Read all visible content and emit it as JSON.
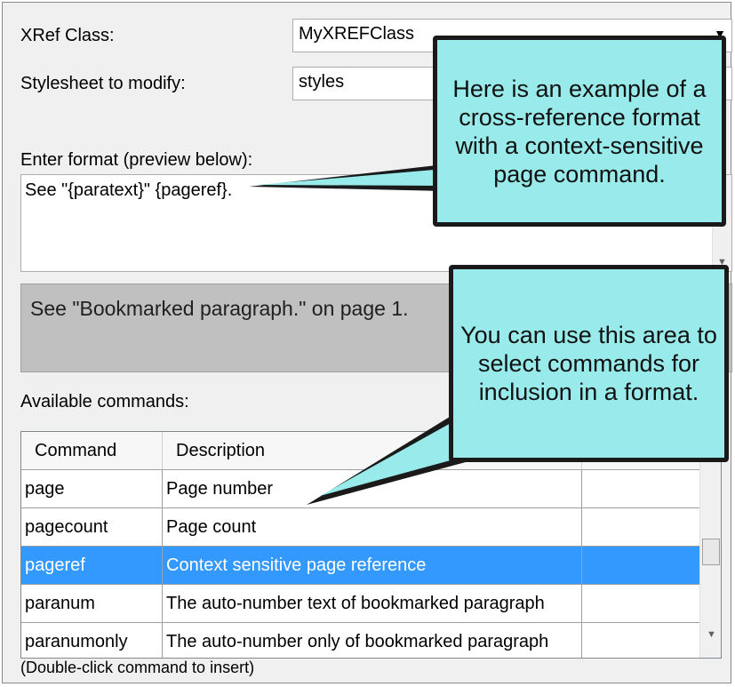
{
  "xref_class": {
    "label": "XRef Class:",
    "value": "MyXREFClass"
  },
  "stylesheet": {
    "label": "Stylesheet to modify:",
    "value": "styles"
  },
  "format": {
    "label": "Enter format (preview below):",
    "value": "See \"{paratext}\" {pageref}."
  },
  "preview": {
    "text": "See \"Bookmarked paragraph.\" on page 1."
  },
  "commands": {
    "label": "Available commands:",
    "columns": [
      "Command",
      "Description"
    ],
    "rows": [
      {
        "command": "page",
        "description": "Page number"
      },
      {
        "command": "pagecount",
        "description": "Page count"
      },
      {
        "command": "pageref",
        "description": "Context sensitive page reference",
        "selected": true
      },
      {
        "command": "paranum",
        "description": "The auto-number text of bookmarked paragraph"
      },
      {
        "command": "paranumonly",
        "description": "The auto-number only of bookmarked paragraph"
      }
    ],
    "hint": "(Double-click command to insert)"
  },
  "callouts": {
    "top": "Here is an example of a cross-reference format with a context-sensitive page command.",
    "bottom": "You can use this area to select commands for inclusion in a format."
  },
  "colors": {
    "callout_fill": "#99ebeb",
    "selection": "#3399ff",
    "preview_bg": "#c0c0c0"
  }
}
